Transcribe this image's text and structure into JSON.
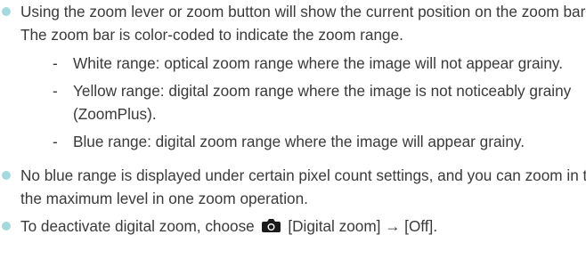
{
  "bullets": [
    {
      "text": "Using the zoom lever or zoom button will show the current position on the zoom bar. The zoom bar is color-coded to indicate the zoom range.",
      "sub_items": [
        {
          "dash": "-",
          "text": "White range: optical zoom range where the image will not appear grainy."
        },
        {
          "dash": "-",
          "text": "Yellow range: digital zoom range where the image is not noticeably grainy (ZoomPlus)."
        },
        {
          "dash": "-",
          "text": "Blue range: digital zoom range where the image will appear grainy."
        }
      ]
    },
    {
      "text": "No blue range is displayed under certain pixel count settings, and you can zoom in to the maximum level in one zoom operation."
    },
    {
      "text_before_icon": "To deactivate digital zoom, choose",
      "icon": "camera-icon",
      "text_after_icon": "[Digital zoom] → [Off]."
    }
  ],
  "colors": {
    "bullet": "#a6d9dd",
    "text": "#3a3a3a",
    "icon": "#1a1a1a"
  }
}
